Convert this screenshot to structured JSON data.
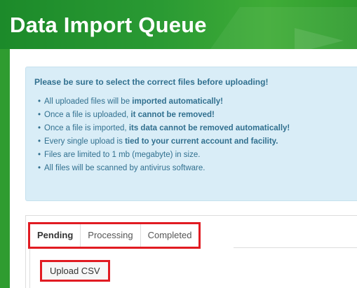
{
  "header": {
    "title": "Data Import Queue"
  },
  "notice": {
    "lead": "Please be sure to select the correct files before uploading!",
    "items": [
      {
        "pre": "All uploaded files will be ",
        "bold": "imported automatically!",
        "post": ""
      },
      {
        "pre": "Once a file is uploaded, ",
        "bold": "it cannot be removed!",
        "post": ""
      },
      {
        "pre": "Once a file is imported, ",
        "bold": "its data cannot be removed automatically!",
        "post": ""
      },
      {
        "pre": "Every single upload is ",
        "bold": "tied to your current account and facility.",
        "post": ""
      },
      {
        "pre": "Files are limited to 1 mb (megabyte) in size.",
        "bold": "",
        "post": ""
      },
      {
        "pre": "All files will be scanned by antivirus software.",
        "bold": "",
        "post": ""
      }
    ]
  },
  "tabs": [
    {
      "label": "Pending"
    },
    {
      "label": "Processing"
    },
    {
      "label": "Completed"
    }
  ],
  "active_tab": "Pending",
  "upload": {
    "label": "Upload CSV"
  },
  "colors": {
    "header_green": "#2a9a33",
    "highlight_red": "#e11b22",
    "notice_bg": "#d9edf7",
    "notice_text": "#31708f"
  }
}
